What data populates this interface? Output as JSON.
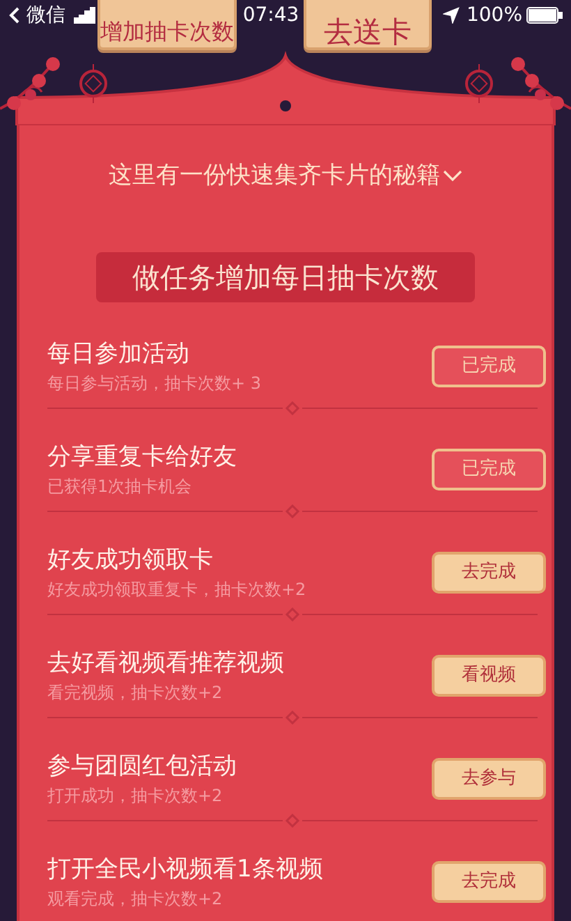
{
  "status_bar": {
    "back_app": "微信",
    "time": "07:43",
    "battery": "100%"
  },
  "top_buttons": [
    {
      "label": "增加抽卡次数"
    },
    {
      "label": "去送卡"
    }
  ],
  "secret_link": "这里有一份快速集齐卡片的秘籍",
  "section_title": "做任务增加每日抽卡次数",
  "tasks": [
    {
      "title": "每日参加活动",
      "desc": "每日参与活动，抽卡次数+ 3",
      "button": "已完成",
      "done": true
    },
    {
      "title": "分享重复卡给好友",
      "desc": "已获得1次抽卡机会",
      "button": "已完成",
      "done": true
    },
    {
      "title": "好友成功领取卡",
      "desc": "好友成功领取重复卡，抽卡次数+2",
      "button": "去完成",
      "done": false
    },
    {
      "title": "去好看视频看推荐视频",
      "desc": "看完视频，抽卡次数+2",
      "button": "看视频",
      "done": false
    },
    {
      "title": "参与团圆红包活动",
      "desc": "打开成功，抽卡次数+2",
      "button": "去参与",
      "done": false
    },
    {
      "title": "打开全民小视频看1条视频",
      "desc": "观看完成，抽卡次数+2",
      "button": "去完成",
      "done": false
    }
  ]
}
